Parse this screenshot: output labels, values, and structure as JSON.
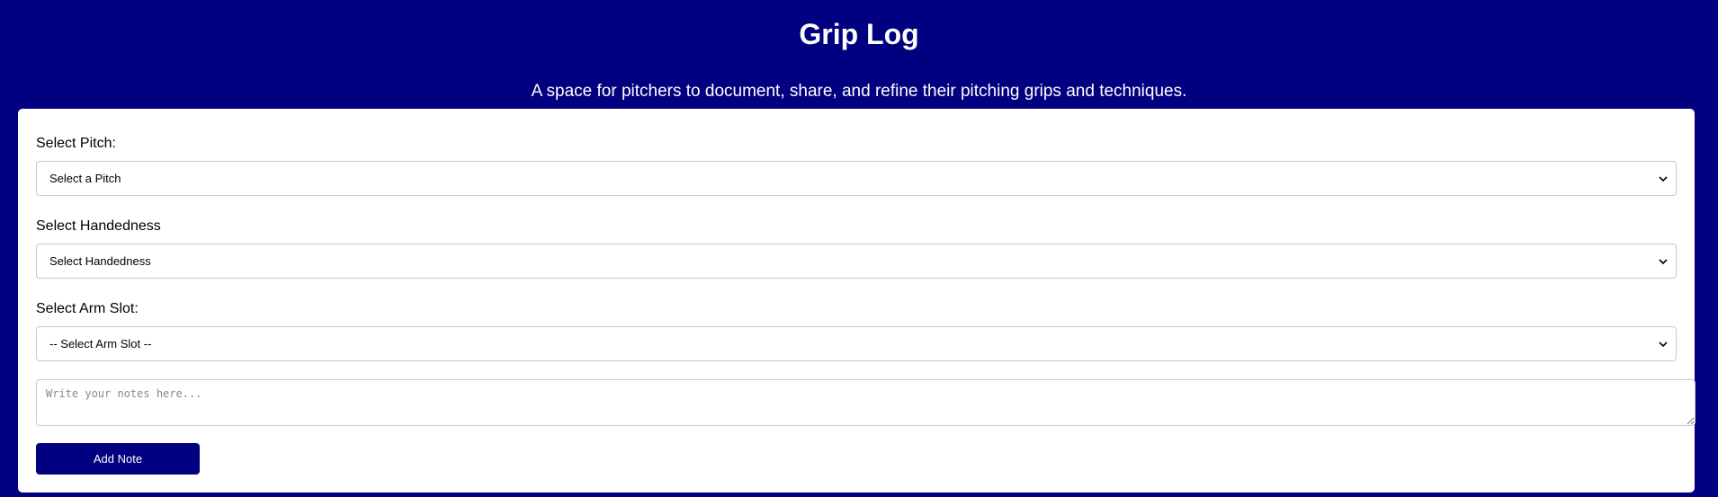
{
  "header": {
    "title": "Grip Log",
    "subtitle": "A space for pitchers to document, share, and refine their pitching grips and techniques."
  },
  "form": {
    "pitch": {
      "label": "Select Pitch:",
      "selected": "Select a Pitch"
    },
    "handedness": {
      "label": "Select Handedness",
      "selected": "Select Handedness"
    },
    "arm_slot": {
      "label": "Select Arm Slot:",
      "selected": "-- Select Arm Slot --"
    },
    "notes": {
      "placeholder": "Write your notes here...",
      "value": ""
    },
    "add_button_label": "Add Note"
  },
  "icons": {
    "dropdown": "chevron-down-icon",
    "resize": "resize-grip-icon"
  },
  "colors": {
    "background": "#000080",
    "card": "#ffffff",
    "button": "#000080",
    "button_text": "#ffffff"
  }
}
